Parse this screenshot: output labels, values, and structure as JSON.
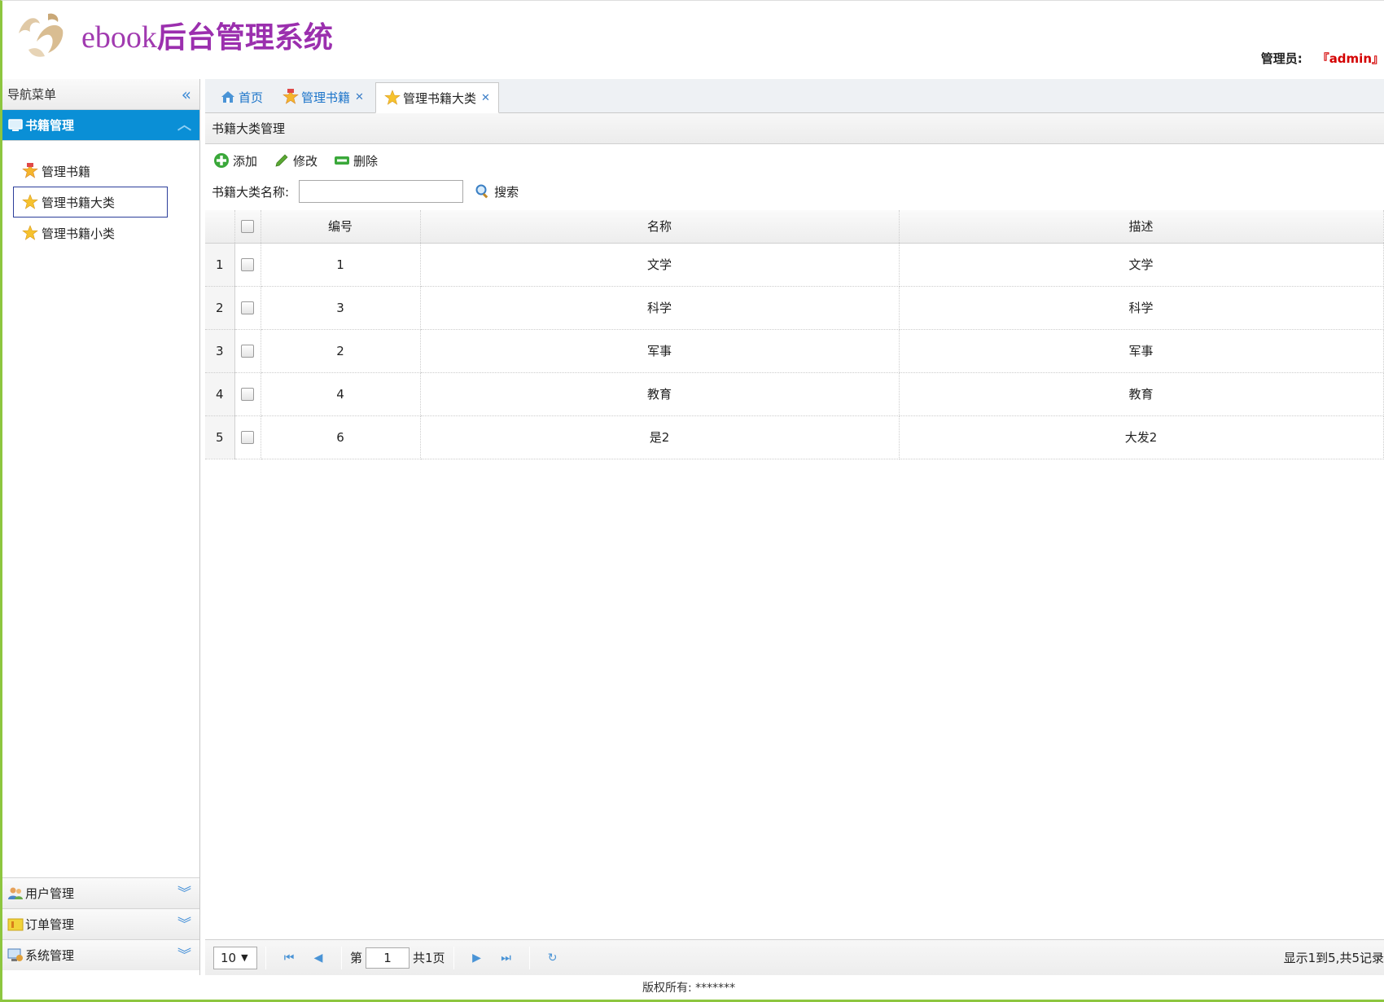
{
  "header": {
    "logo_en": "ebook",
    "logo_zh": "后台管理系统",
    "admin_label": "管理员:",
    "admin_name": "『admin』"
  },
  "sidebar": {
    "title": "导航菜单",
    "sections": [
      {
        "label": "书籍管理",
        "expanded": true,
        "icon": "monitor-icon"
      },
      {
        "label": "用户管理",
        "expanded": false,
        "icon": "users-icon"
      },
      {
        "label": "订单管理",
        "expanded": false,
        "icon": "order-icon"
      },
      {
        "label": "系统管理",
        "expanded": false,
        "icon": "system-icon"
      }
    ],
    "book_items": [
      {
        "label": "管理书籍",
        "icon": "award-star-icon"
      },
      {
        "label": "管理书籍大类",
        "icon": "star-icon",
        "selected": true
      },
      {
        "label": "管理书籍小类",
        "icon": "star-icon"
      }
    ]
  },
  "tabs": [
    {
      "label": "首页",
      "icon": "home-icon",
      "closable": false
    },
    {
      "label": "管理书籍",
      "icon": "award-star-icon",
      "closable": true
    },
    {
      "label": "管理书籍大类",
      "icon": "star-icon",
      "closable": true,
      "active": true
    }
  ],
  "panel": {
    "title": "书籍大类管理",
    "toolbar": {
      "add": "添加",
      "edit": "修改",
      "delete": "删除"
    },
    "search": {
      "label": "书籍大类名称:",
      "value": "",
      "button": "搜索"
    }
  },
  "grid": {
    "columns": [
      "编号",
      "名称",
      "描述"
    ],
    "rows": [
      {
        "n": "1",
        "id": "1",
        "name": "文学",
        "desc": "文学"
      },
      {
        "n": "2",
        "id": "3",
        "name": "科学",
        "desc": "科学"
      },
      {
        "n": "3",
        "id": "2",
        "name": "军事",
        "desc": "军事"
      },
      {
        "n": "4",
        "id": "4",
        "name": "教育",
        "desc": "教育"
      },
      {
        "n": "5",
        "id": "6",
        "name": "是2",
        "desc": "大发2"
      }
    ]
  },
  "pager": {
    "page_size": "10",
    "page_prefix": "第",
    "page_value": "1",
    "page_total": "共1页",
    "info": "显示1到5,共5记录"
  },
  "footer": {
    "copyright": "版权所有: *******"
  },
  "colors": {
    "accent": "#0a8fd6",
    "brand": "#9b2fae",
    "frame": "#8dc63f",
    "admin": "#d40000"
  }
}
